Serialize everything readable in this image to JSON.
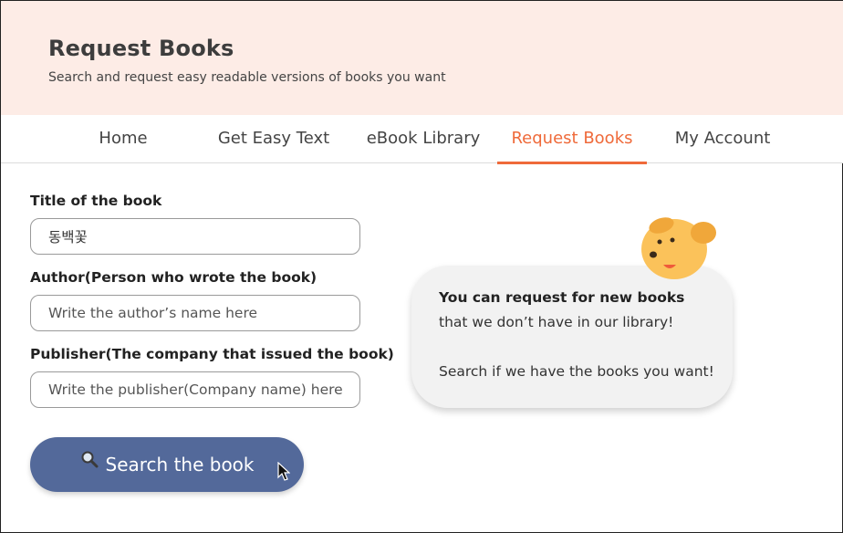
{
  "header": {
    "title": "Request Books",
    "subtitle": "Search and request easy readable versions of books you want"
  },
  "nav": {
    "items": [
      {
        "label": "Home"
      },
      {
        "label": "Get Easy Text"
      },
      {
        "label": "eBook Library"
      },
      {
        "label": "Request Books",
        "active": true
      },
      {
        "label": "My Account"
      }
    ],
    "active_color": "#ef6a3a"
  },
  "form": {
    "title_label": "Title of the book",
    "title_value": "동백꽃",
    "author_label": "Author(Person who wrote the book)",
    "author_placeholder": "Write the author’s name here",
    "publisher_label": "Publisher(The company that issued the book)",
    "publisher_placeholder": "Write the publisher(Company name) here",
    "search_button": "Search the book",
    "search_icon": "magnifier-icon",
    "button_color": "#53699a"
  },
  "bubble": {
    "line1": "You can request for new books",
    "line2": "that we don’t have in our library!",
    "line3": "Search if we have the books you want!"
  },
  "mascot": {
    "icon": "dog-mascot-icon",
    "color": "#fbc25a"
  }
}
